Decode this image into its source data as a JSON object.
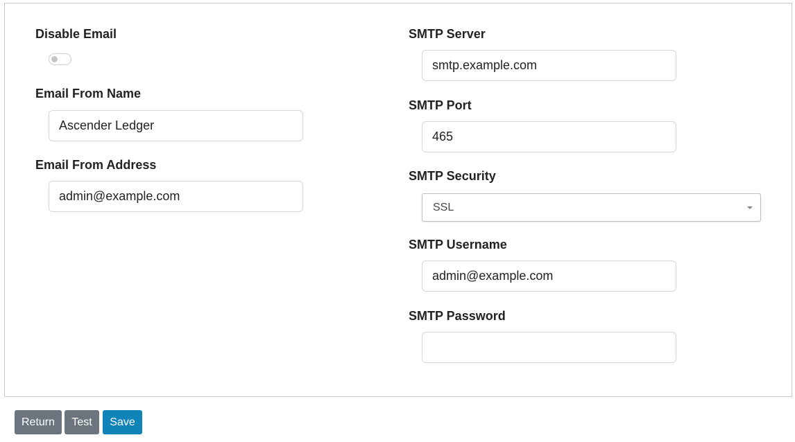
{
  "left": {
    "disable_email_label": "Disable Email",
    "disable_email_enabled": false,
    "from_name_label": "Email From Name",
    "from_name_value": "Ascender Ledger",
    "from_address_label": "Email From Address",
    "from_address_value": "admin@example.com"
  },
  "right": {
    "server_label": "SMTP Server",
    "server_value": "smtp.example.com",
    "port_label": "SMTP Port",
    "port_value": "465",
    "security_label": "SMTP Security",
    "security_value": "SSL",
    "username_label": "SMTP Username",
    "username_value": "admin@example.com",
    "password_label": "SMTP Password",
    "password_value": ""
  },
  "buttons": {
    "return_label": "Return",
    "test_label": "Test",
    "save_label": "Save"
  },
  "colors": {
    "primary": "#1084b8",
    "secondary": "#6c757d"
  }
}
